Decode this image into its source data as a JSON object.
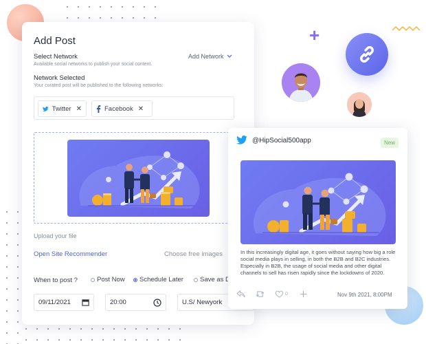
{
  "add_post": {
    "title": "Add Post",
    "select_network_label": "Select Network",
    "select_network_hint": "Available social networks to publish your social content.",
    "add_network_label": "Add Network",
    "network_selected_label": "Network Selected",
    "network_selected_hint": "Your curated post will be published to the following networks:",
    "networks": [
      {
        "name": "Twitter",
        "icon": "twitter-icon",
        "color": "#1da1f2"
      },
      {
        "name": "Facebook",
        "icon": "facebook-icon",
        "color": "#3b5998"
      }
    ],
    "upload_label": "Upload your file",
    "open_site_label": "Open Site Recommender",
    "choose_free_label": "Choose free images",
    "when_label": "When to post ?",
    "options": [
      "Post Now",
      "Schedule Later",
      "Save as Draft"
    ],
    "selected_option": "Schedule Later",
    "date_value": "09/11/2021",
    "time_value": "20:00",
    "timezone_value": "U.S/ Newyork"
  },
  "tweet": {
    "handle": "@HipSocial500app",
    "badge": "New",
    "text": "In this increasingly digital age, it goes without saying how big a role social media plays in selling, in both the B2B and B2C industries. Especially in B2B, the usage of social media and other digital channels to sell has risen rapidly since the lockdowns of 2020.",
    "likes": "0",
    "date": "Nov 9th 2021, 8:00PM"
  },
  "colors": {
    "accent": "#4a63d8",
    "illustration": "#6f7cf2",
    "twitter": "#1da1f2",
    "badge_bg": "#e8f6e3",
    "badge_text": "#6cb35a"
  }
}
